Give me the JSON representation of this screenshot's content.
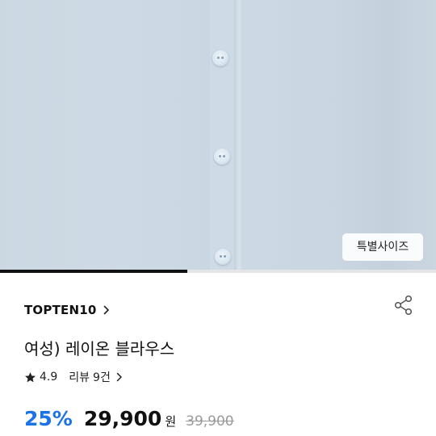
{
  "product_image": {
    "alt": "light blue blouse with buttons",
    "size_badge": "특별사이즈",
    "carousel_progress": 0.43
  },
  "brand": {
    "name": "TOPTEN10",
    "chevron_icon": "chevron-right-icon"
  },
  "share_icon": "share-icon",
  "product": {
    "title": "여성) 레이온 블라우스"
  },
  "rating": {
    "star_icon": "star-icon",
    "score": "4.9",
    "review_label": "리뷰",
    "review_count": "9건",
    "chevron_icon": "chevron-right-icon"
  },
  "price": {
    "discount": "25%",
    "sale_price": "29,900",
    "currency": "원",
    "original_price": "39,900",
    "discount_color": "#1a73e8"
  }
}
